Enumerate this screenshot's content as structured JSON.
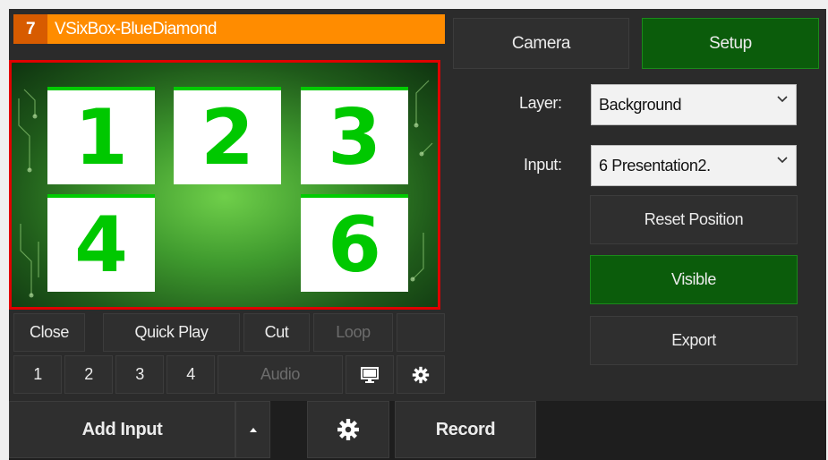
{
  "input": {
    "number": "7",
    "title": "VSixBox-BlueDiamond",
    "tiles": [
      "1",
      "2",
      "3",
      "4",
      "6"
    ]
  },
  "controls": {
    "close": "Close",
    "quick_play": "Quick Play",
    "cut": "Cut",
    "loop": "Loop",
    "overlays": [
      "1",
      "2",
      "3",
      "4"
    ],
    "audio": "Audio"
  },
  "side": {
    "camera": "Camera",
    "setup": "Setup",
    "layer_label": "Layer:",
    "layer_value": "Background",
    "input_label": "Input:",
    "input_value": "6 Presentation2.",
    "reset_position": "Reset Position",
    "visible": "Visible",
    "export": "Export"
  },
  "bottom": {
    "add_input": "Add Input",
    "record": "Record"
  },
  "icons": {
    "monitor": "monitor-icon",
    "gear": "gear-icon",
    "caret": "caret-up-icon",
    "chevron": "chevron-down-icon"
  },
  "colors": {
    "title_bar": "#ff8c00",
    "number_badge": "#d75b00",
    "active_green": "#0b5c0b",
    "selection_border": "#e00000",
    "tile_digit": "#00c800"
  }
}
